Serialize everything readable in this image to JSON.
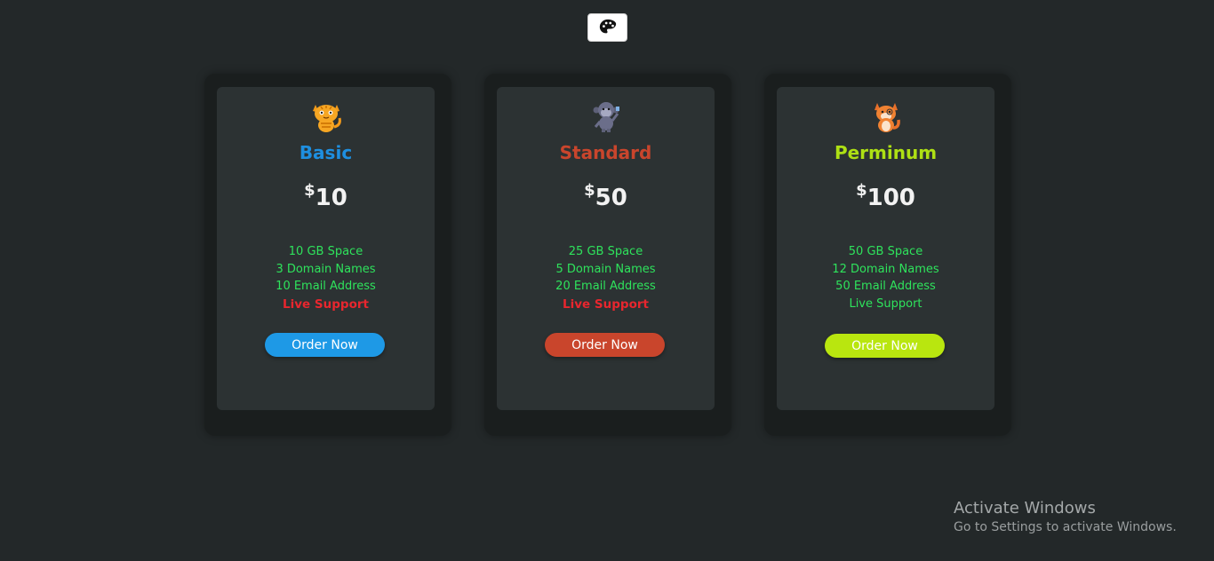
{
  "plans": [
    {
      "name": "Basic",
      "color": "#1e8fe0",
      "icon": "cat-icon",
      "currency": "$",
      "price": "10",
      "features": [
        "10 GB Space",
        "3 Domain Names",
        "10 Email Address",
        "Live Support"
      ],
      "features_available": [
        true,
        true,
        true,
        false
      ],
      "button_label": "Order Now",
      "button_color": "#1e99e6"
    },
    {
      "name": "Standard",
      "color": "#c9452c",
      "icon": "monkey-icon",
      "currency": "$",
      "price": "50",
      "features": [
        "25 GB Space",
        "5 Domain Names",
        "20 Email Address",
        "Live Support"
      ],
      "features_available": [
        true,
        true,
        true,
        false
      ],
      "button_label": "Order Now",
      "button_color": "#c9452c"
    },
    {
      "name": "Perminum",
      "color": "#aee014",
      "icon": "fox-icon",
      "currency": "$",
      "price": "100",
      "features": [
        "50 GB Space",
        "12 Domain Names",
        "50 Email Address",
        "Live Support"
      ],
      "features_available": [
        true,
        true,
        true,
        true
      ],
      "button_label": "Order Now",
      "button_color": "#b9e60f"
    }
  ],
  "theme_button": {
    "icon": "palette-icon"
  },
  "watermark": {
    "title": "Activate Windows",
    "subtitle": "Go to Settings to activate Windows."
  }
}
